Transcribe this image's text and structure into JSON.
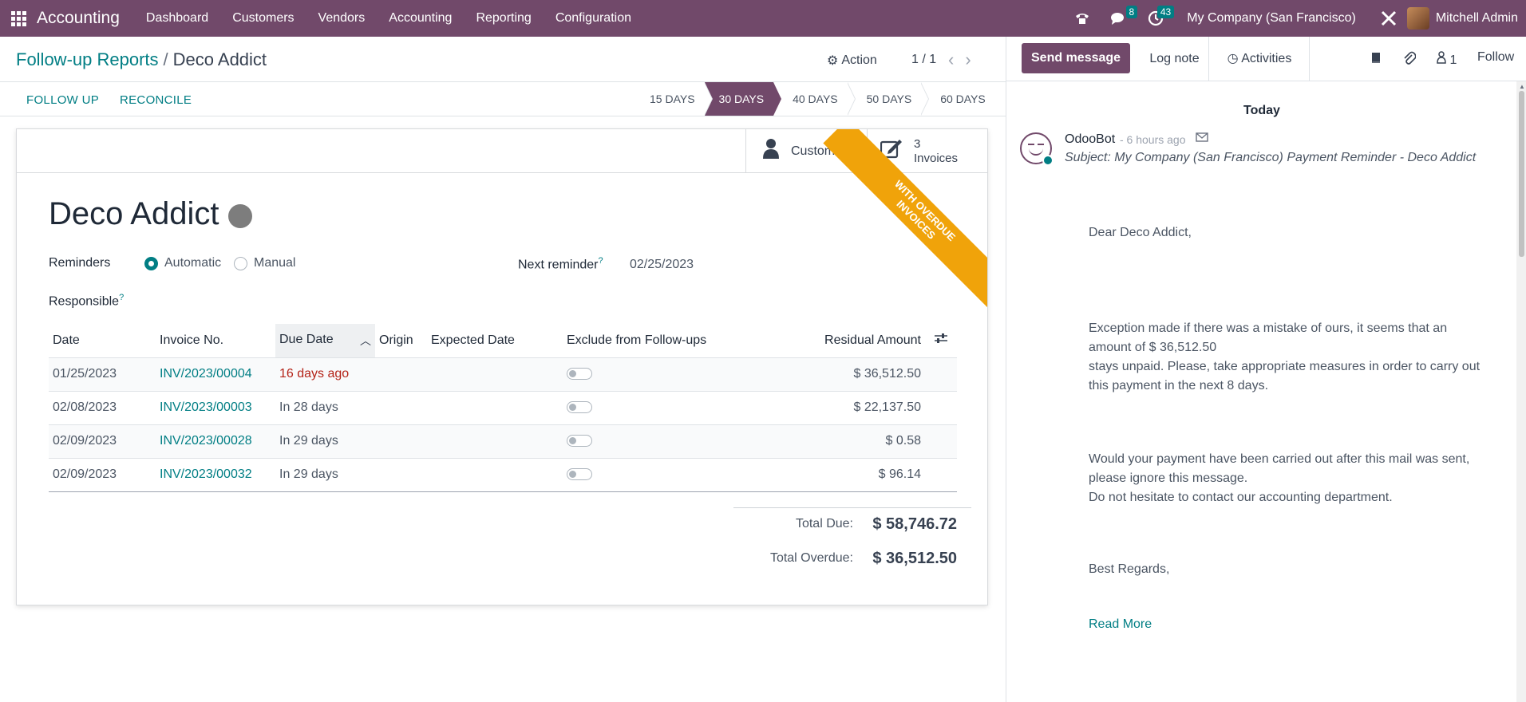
{
  "navbar": {
    "brand": "Accounting",
    "menu": [
      "Dashboard",
      "Customers",
      "Vendors",
      "Accounting",
      "Reporting",
      "Configuration"
    ],
    "messages_badge": "8",
    "activities_badge": "43",
    "company": "My Company (San Francisco)",
    "user": "Mitchell Admin"
  },
  "control_panel": {
    "breadcrumb_parent": "Follow-up Reports",
    "breadcrumb_sep": "/",
    "breadcrumb_current": "Deco Addict",
    "action_label": "Action",
    "pager": "1 / 1",
    "follow_up_label": "FOLLOW UP",
    "reconcile_label": "RECONCILE",
    "stages": [
      "15 DAYS",
      "30 DAYS",
      "40 DAYS",
      "50 DAYS",
      "60 DAYS"
    ],
    "active_stage": "30 DAYS"
  },
  "sheet": {
    "customer_button": "Customer",
    "invoices_count": "3",
    "invoices_label": "Invoices",
    "ribbon_line1": "WITH OVERDUE",
    "ribbon_line2": "INVOICES",
    "partner_name": "Deco Addict",
    "reminders_label": "Reminders",
    "reminder_options": [
      "Automatic",
      "Manual"
    ],
    "reminder_selected": "Automatic",
    "next_reminder_label": "Next reminder",
    "next_reminder_value": "02/25/2023",
    "responsible_label": "Responsible",
    "help_mark": "?",
    "table": {
      "headers": [
        "Date",
        "Invoice No.",
        "Due Date",
        "Origin",
        "Expected Date",
        "Exclude from Follow-ups",
        "Residual Amount"
      ],
      "rows": [
        {
          "date": "01/25/2023",
          "invoice": "INV/2023/00004",
          "due": "16 days ago",
          "amount": "$ 36,512.50"
        },
        {
          "date": "02/08/2023",
          "invoice": "INV/2023/00003",
          "due": "In 28 days",
          "amount": "$ 22,137.50"
        },
        {
          "date": "02/09/2023",
          "invoice": "INV/2023/00028",
          "due": "In 29 days",
          "amount": "$ 0.58"
        },
        {
          "date": "02/09/2023",
          "invoice": "INV/2023/00032",
          "due": "In 29 days",
          "amount": "$ 96.14"
        }
      ]
    },
    "total_due_label": "Total Due:",
    "total_due_value": "$ 58,746.72",
    "total_overdue_label": "Total Overdue:",
    "total_overdue_value": "$ 36,512.50"
  },
  "chatter": {
    "send_message": "Send message",
    "log_note": "Log note",
    "activities": "Activities",
    "followers_count": "1",
    "follow": "Follow",
    "date_separator": "Today",
    "author": "OdooBot",
    "time": "- 6 hours ago",
    "subject": "Subject: My Company (San Francisco) Payment Reminder - Deco Addict",
    "greeting": "Dear Deco Addict,",
    "para1_line1": "Exception made if there was a mistake of ours, it seems that an",
    "para1_line2": "amount of $ 36,512.50",
    "para1_line3": "stays unpaid. Please, take appropriate measures in order to carry out",
    "para1_line4": "this payment in the next 8 days.",
    "para2_line1": "Would your payment have been carried out after this mail was sent,",
    "para2_line2": "please ignore this message.",
    "para2_line3": "Do not hesitate to contact our accounting department.",
    "closing": "Best Regards,",
    "read_more": "Read More"
  }
}
